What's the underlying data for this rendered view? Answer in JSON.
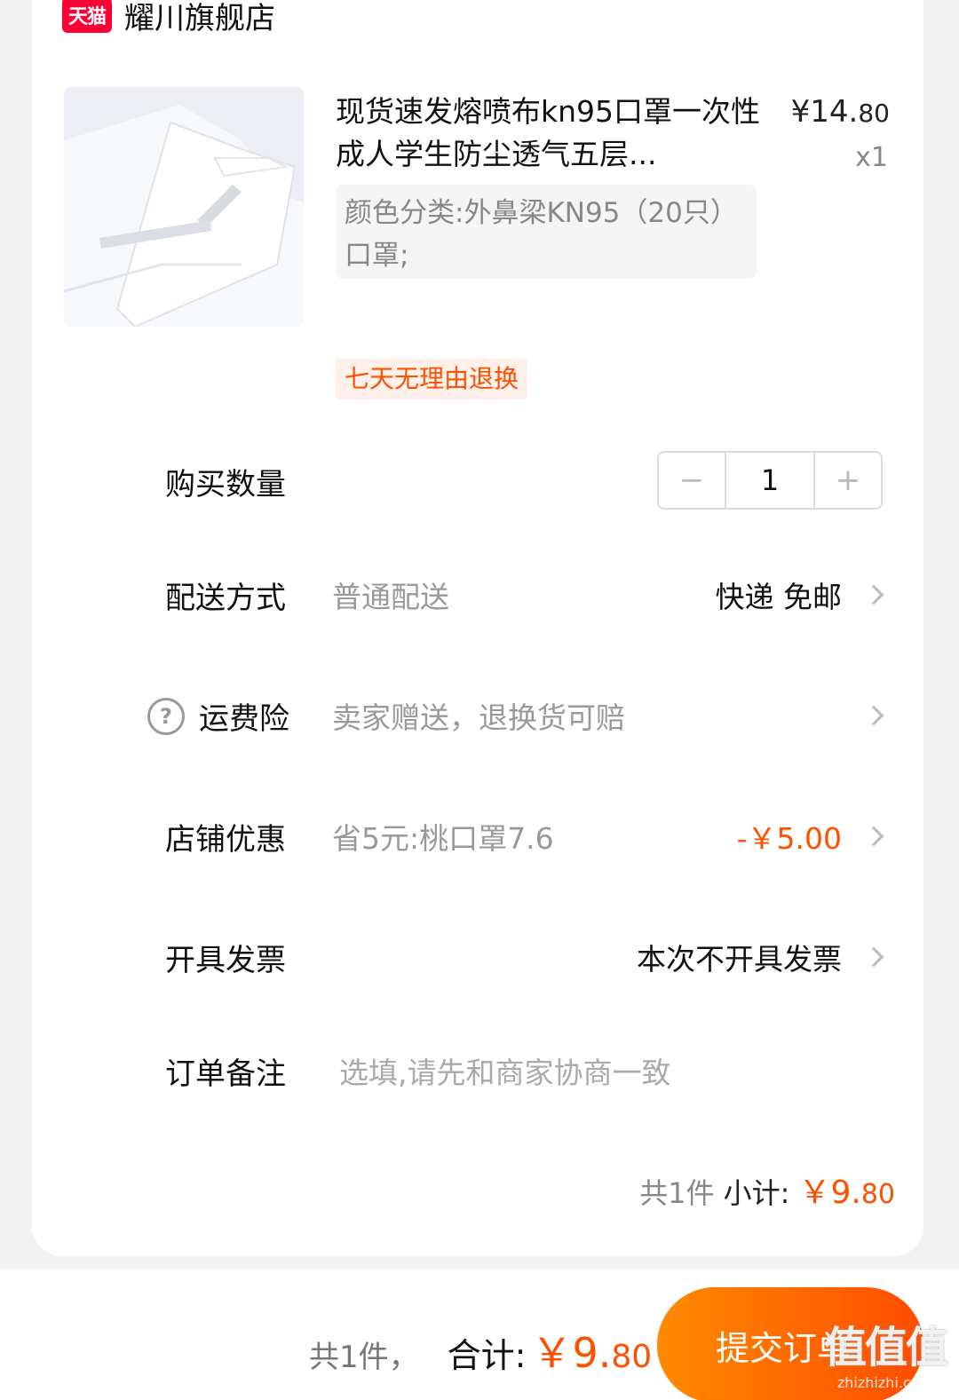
{
  "store": {
    "badge": "天猫",
    "name": "耀川旗舰店"
  },
  "item": {
    "title": "现货速发熔喷布kn95口罩一次性成人学生防尘透气五层...",
    "price_symbol": "¥",
    "price_int": "14.",
    "price_dec": "80",
    "quantity_text": "x1",
    "sku": "颜色分类:外鼻梁KN95（20只）口罩;",
    "tag": "七天无理由退换"
  },
  "rows": {
    "quantity": {
      "label": "购买数量",
      "value": "1",
      "minus": "−",
      "plus": "+"
    },
    "delivery": {
      "label": "配送方式",
      "sub": "普通配送",
      "value": "快递 免邮"
    },
    "insurance": {
      "label": "运费险",
      "sub": "卖家赠送，退换货可赔",
      "icon": "?"
    },
    "discount": {
      "label": "店铺优惠",
      "sub": "省5元:桃口罩7.6",
      "value": "-￥5.00"
    },
    "invoice": {
      "label": "开具发票",
      "value": "本次不开具发票"
    },
    "note": {
      "label": "订单备注",
      "placeholder": "选填,请先和商家协商一致"
    }
  },
  "subtotal": {
    "count": "共1件",
    "label": "小计:",
    "symbol": "￥",
    "int": "9.",
    "dec": "80"
  },
  "footer": {
    "count": "共1件，",
    "label": "合计:",
    "symbol": "￥",
    "int": "9.",
    "dec": "80",
    "submit": "提交订单"
  },
  "watermark": {
    "big": "值值值",
    "small": "zhizhizhi.com"
  },
  "colors": {
    "accent": "#ff5000",
    "tmall": "#ff0036"
  }
}
